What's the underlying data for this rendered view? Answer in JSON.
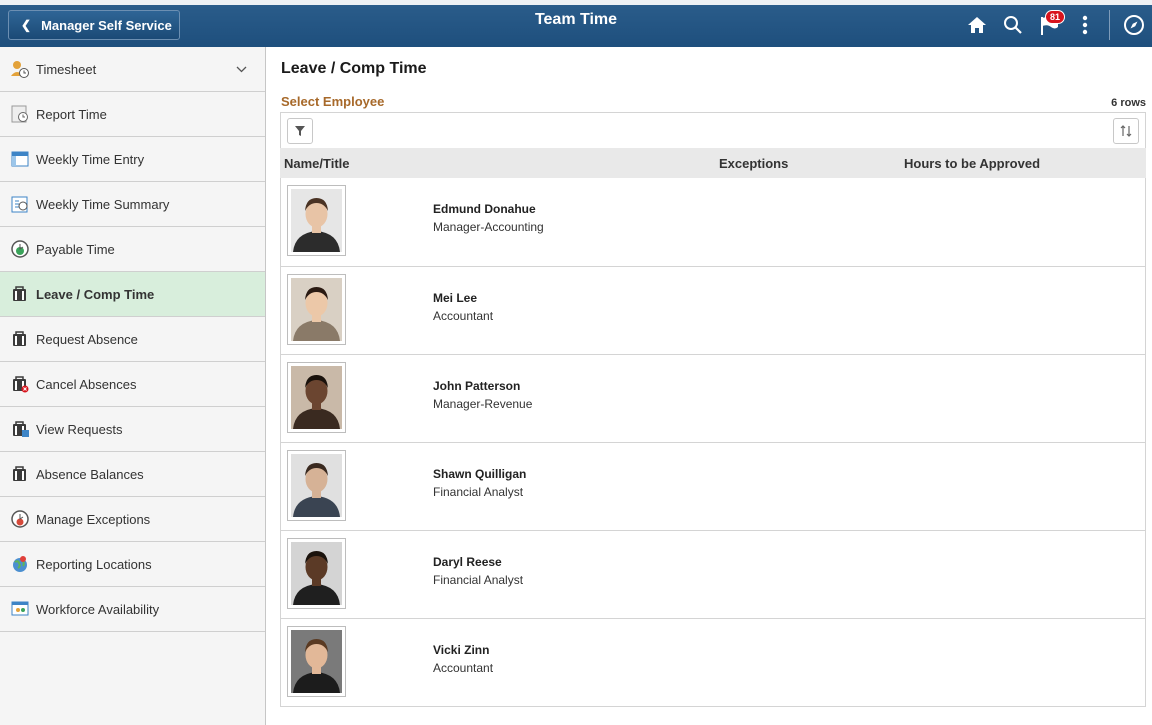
{
  "header": {
    "back_label": "Manager Self Service",
    "title": "Team Time",
    "notification_count": "81",
    "icons": [
      "home-icon",
      "search-icon",
      "notifications-flag-icon",
      "actions-menu-icon",
      "navbar-compass-icon"
    ],
    "colors": {
      "bar": "#1e4f7d",
      "badge": "#d8141d"
    }
  },
  "sidebar": {
    "items": [
      {
        "label": "Timesheet",
        "icon": "timesheet-icon",
        "active": false,
        "has_caret": true
      },
      {
        "label": "Report Time",
        "icon": "report-time-icon",
        "active": false
      },
      {
        "label": "Weekly Time Entry",
        "icon": "weekly-time-entry-icon",
        "active": false
      },
      {
        "label": "Weekly Time Summary",
        "icon": "weekly-time-summary-icon",
        "active": false
      },
      {
        "label": "Payable Time",
        "icon": "payable-time-icon",
        "active": false
      },
      {
        "label": "Leave / Comp Time",
        "icon": "leave-icon",
        "active": true
      },
      {
        "label": "Request Absence",
        "icon": "request-absence-icon",
        "active": false
      },
      {
        "label": "Cancel Absences",
        "icon": "cancel-absences-icon",
        "active": false
      },
      {
        "label": "View Requests",
        "icon": "view-requests-icon",
        "active": false
      },
      {
        "label": "Absence Balances",
        "icon": "absence-balances-icon",
        "active": false
      },
      {
        "label": "Manage Exceptions",
        "icon": "manage-exceptions-icon",
        "active": false
      },
      {
        "label": "Reporting Locations",
        "icon": "reporting-locations-icon",
        "active": false
      },
      {
        "label": "Workforce Availability",
        "icon": "workforce-availability-icon",
        "active": false
      }
    ],
    "active_color": "#d8eedc"
  },
  "main": {
    "page_title": "Leave / Comp Time",
    "section_title": "Select Employee",
    "row_count": "6 rows",
    "columns": {
      "name": "Name/Title",
      "exceptions": "Exceptions",
      "hours": "Hours to be Approved"
    },
    "employees": [
      {
        "name": "Edmund Donahue",
        "title": "Manager-Accounting",
        "skin": "#e8c4a6",
        "hair": "#4a3324",
        "shirt": "#2c2c2c",
        "bg": "#e6e6e6"
      },
      {
        "name": "Mei Lee",
        "title": "Accountant",
        "skin": "#ecc8a8",
        "hair": "#2a1a12",
        "shirt": "#8a7a68",
        "bg": "#d9d0c4"
      },
      {
        "name": "John Patterson",
        "title": "Manager-Revenue",
        "skin": "#6b4530",
        "hair": "#1a120c",
        "shirt": "#3a2a20",
        "bg": "#c9b9a8"
      },
      {
        "name": "Shawn Quilligan",
        "title": "Financial Analyst",
        "skin": "#d6b296",
        "hair": "#3a2a20",
        "shirt": "#3a4452",
        "bg": "#e0e0e0"
      },
      {
        "name": "Daryl Reese",
        "title": "Financial Analyst",
        "skin": "#5b3a26",
        "hair": "#1a120c",
        "shirt": "#1f1f1f",
        "bg": "#d4d4d4"
      },
      {
        "name": "Vicki Zinn",
        "title": "Accountant",
        "skin": "#e2b898",
        "hair": "#5a3a22",
        "shirt": "#1c1c1c",
        "bg": "#7a7a7a"
      }
    ]
  }
}
